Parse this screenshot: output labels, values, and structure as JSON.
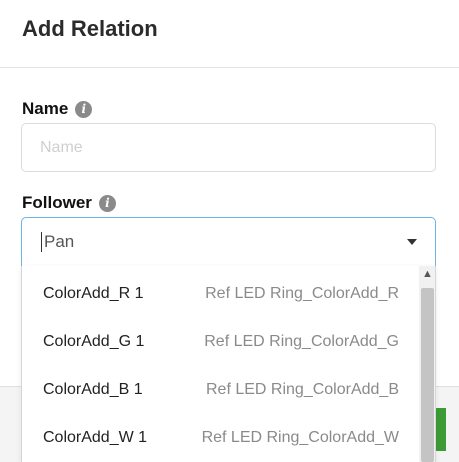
{
  "dialog": {
    "title": "Add Relation"
  },
  "name_field": {
    "label": "Name",
    "placeholder": "Name",
    "value": ""
  },
  "follower_field": {
    "label": "Follower",
    "value": "Pan",
    "options": [
      {
        "name": "ColorAdd_R 1",
        "description": "Ref LED Ring_ColorAdd_R"
      },
      {
        "name": "ColorAdd_G 1",
        "description": "Ref LED Ring_ColorAdd_G"
      },
      {
        "name": "ColorAdd_B 1",
        "description": "Ref LED Ring_ColorAdd_B"
      },
      {
        "name": "ColorAdd_W 1",
        "description": "Ref LED Ring_ColorAdd_W"
      }
    ]
  },
  "icons": {
    "info": "info-icon",
    "dropdown": "chevron-down-icon",
    "scroll_up": "chevron-up-icon"
  },
  "colors": {
    "focus_border": "#6fb2e6",
    "primary_button": "#3d9b35"
  }
}
